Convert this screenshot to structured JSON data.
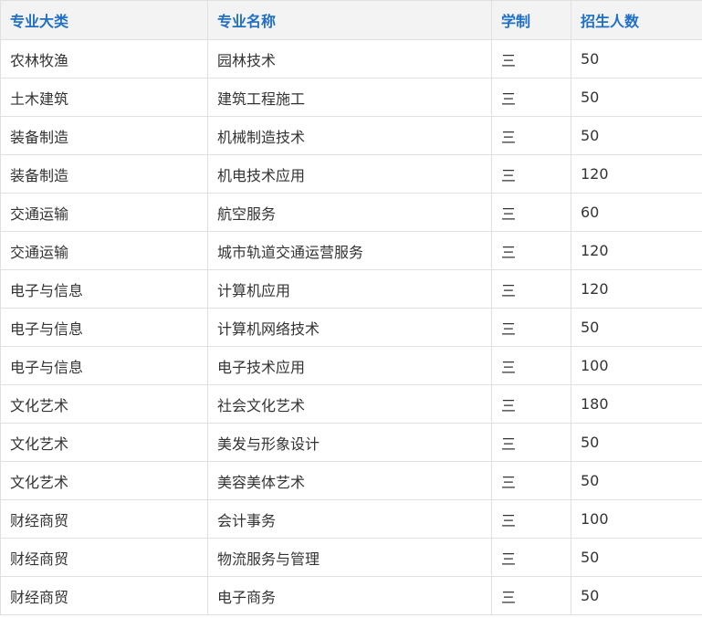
{
  "table": {
    "headers": [
      "专业大类",
      "专业名称",
      "学制",
      "招生人数"
    ],
    "rows": [
      [
        "农林牧渔",
        "园林技术",
        "三",
        "50"
      ],
      [
        "土木建筑",
        "建筑工程施工",
        "三",
        "50"
      ],
      [
        "装备制造",
        "机械制造技术",
        "三",
        "50"
      ],
      [
        "装备制造",
        "机电技术应用",
        "三",
        "120"
      ],
      [
        "交通运输",
        "航空服务",
        "三",
        "60"
      ],
      [
        "交通运输",
        "城市轨道交通运营服务",
        "三",
        "120"
      ],
      [
        "电子与信息",
        "计算机应用",
        "三",
        "120"
      ],
      [
        "电子与信息",
        "计算机网络技术",
        "三",
        "50"
      ],
      [
        "电子与信息",
        "电子技术应用",
        "三",
        "100"
      ],
      [
        "文化艺术",
        "社会文化艺术",
        "三",
        "180"
      ],
      [
        "文化艺术",
        "美发与形象设计",
        "三",
        "50"
      ],
      [
        "文化艺术",
        "美容美体艺术",
        "三",
        "50"
      ],
      [
        "财经商贸",
        "会计事务",
        "三",
        "100"
      ],
      [
        "财经商贸",
        "物流服务与管理",
        "三",
        "50"
      ],
      [
        "财经商贸",
        "电子商务",
        "三",
        "50"
      ]
    ]
  }
}
